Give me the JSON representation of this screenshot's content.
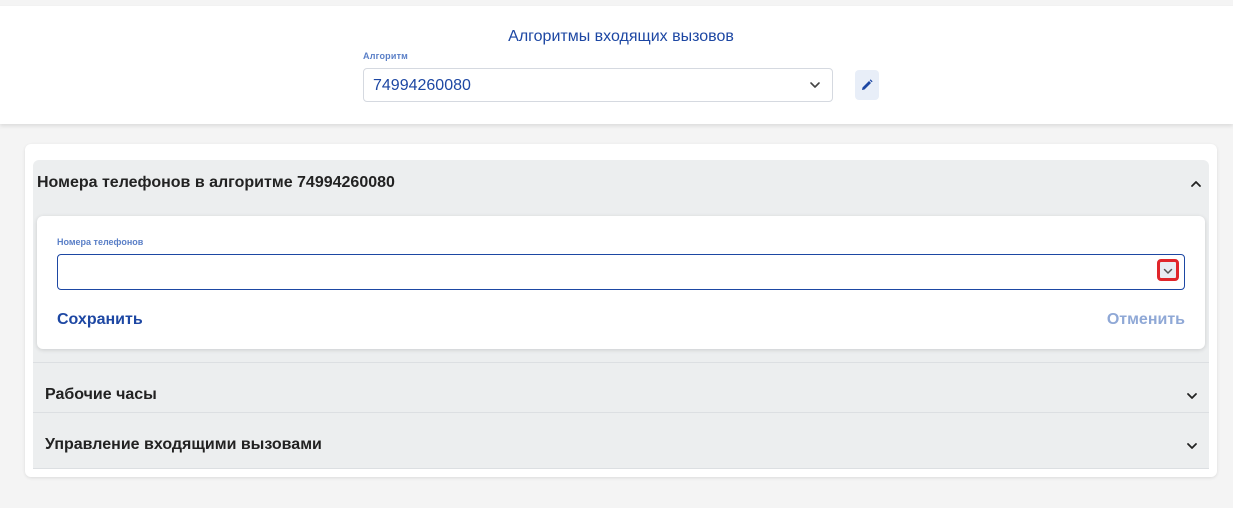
{
  "header": {
    "title": "Алгоритмы входящих вызовов",
    "algorithm_label": "Алгоритм",
    "algorithm_value": "74994260080",
    "icons": {
      "select": "chevron-down-icon",
      "edit": "pencil-icon"
    }
  },
  "section_phones": {
    "title": "Номера телефонов в алгоритме 74994260080",
    "expanded": true,
    "field_label": "Номера телефонов",
    "field_value": "",
    "save_label": "Сохранить",
    "cancel_label": "Отменить",
    "icons": {
      "toggle": "chevron-up-icon",
      "dropdown": "chevron-down-icon"
    }
  },
  "section_hours": {
    "title": "Рабочие часы",
    "expanded": false
  },
  "section_calls": {
    "title": "Управление входящими вызовами",
    "expanded": false
  },
  "colors": {
    "accent": "#1d47a3",
    "label": "#5a7fc7",
    "cancel": "#8fa8d6",
    "highlight": "#e0262b"
  }
}
